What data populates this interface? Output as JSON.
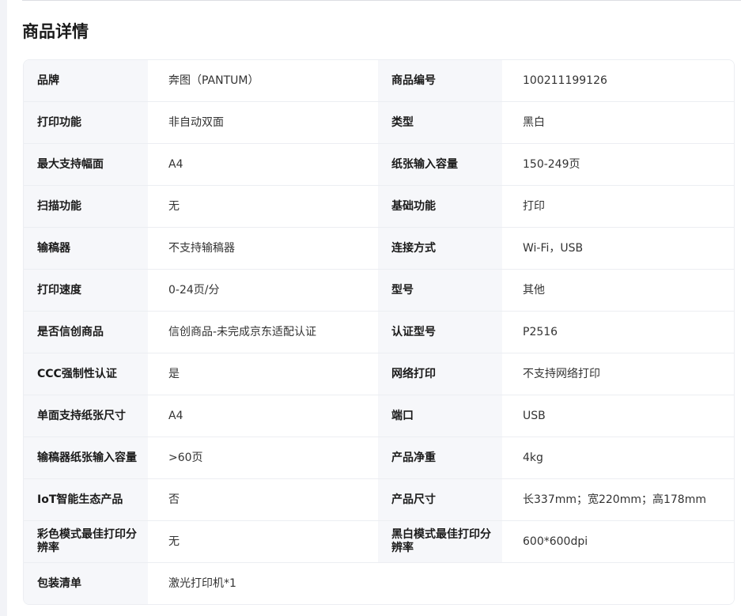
{
  "section": {
    "title": "商品详情"
  },
  "specs": [
    {
      "l1": "品牌",
      "v1": "奔图（PANTUM）",
      "l2": "商品编号",
      "v2": "100211199126"
    },
    {
      "l1": "打印功能",
      "v1": "非自动双面",
      "l2": "类型",
      "v2": "黑白"
    },
    {
      "l1": "最大支持幅面",
      "v1": "A4",
      "l2": "纸张输入容量",
      "v2": "150-249页"
    },
    {
      "l1": "扫描功能",
      "v1": "无",
      "l2": "基础功能",
      "v2": "打印"
    },
    {
      "l1": "输稿器",
      "v1": "不支持输稿器",
      "l2": "连接方式",
      "v2": "Wi-Fi，USB"
    },
    {
      "l1": "打印速度",
      "v1": "0-24页/分",
      "l2": "型号",
      "v2": "其他"
    },
    {
      "l1": "是否信创商品",
      "v1": "信创商品-未完成京东适配认证",
      "l2": "认证型号",
      "v2": "P2516"
    },
    {
      "l1": "CCC强制性认证",
      "v1": "是",
      "l2": "网络打印",
      "v2": "不支持网络打印"
    },
    {
      "l1": "单面支持纸张尺寸",
      "v1": "A4",
      "l2": "端口",
      "v2": "USB"
    },
    {
      "l1": "输稿器纸张输入容量",
      "v1": ">60页",
      "l2": "产品净重",
      "v2": "4kg"
    },
    {
      "l1": "IoT智能生态产品",
      "v1": "否",
      "l2": "产品尺寸",
      "v2": "长337mm；宽220mm；高178mm"
    },
    {
      "l1": "彩色模式最佳打印分辨率",
      "v1": "无",
      "l2": "黑白模式最佳打印分辨率",
      "v2": "600*600dpi"
    },
    {
      "l1": "包装清单",
      "v1": "激光打印机*1"
    }
  ]
}
